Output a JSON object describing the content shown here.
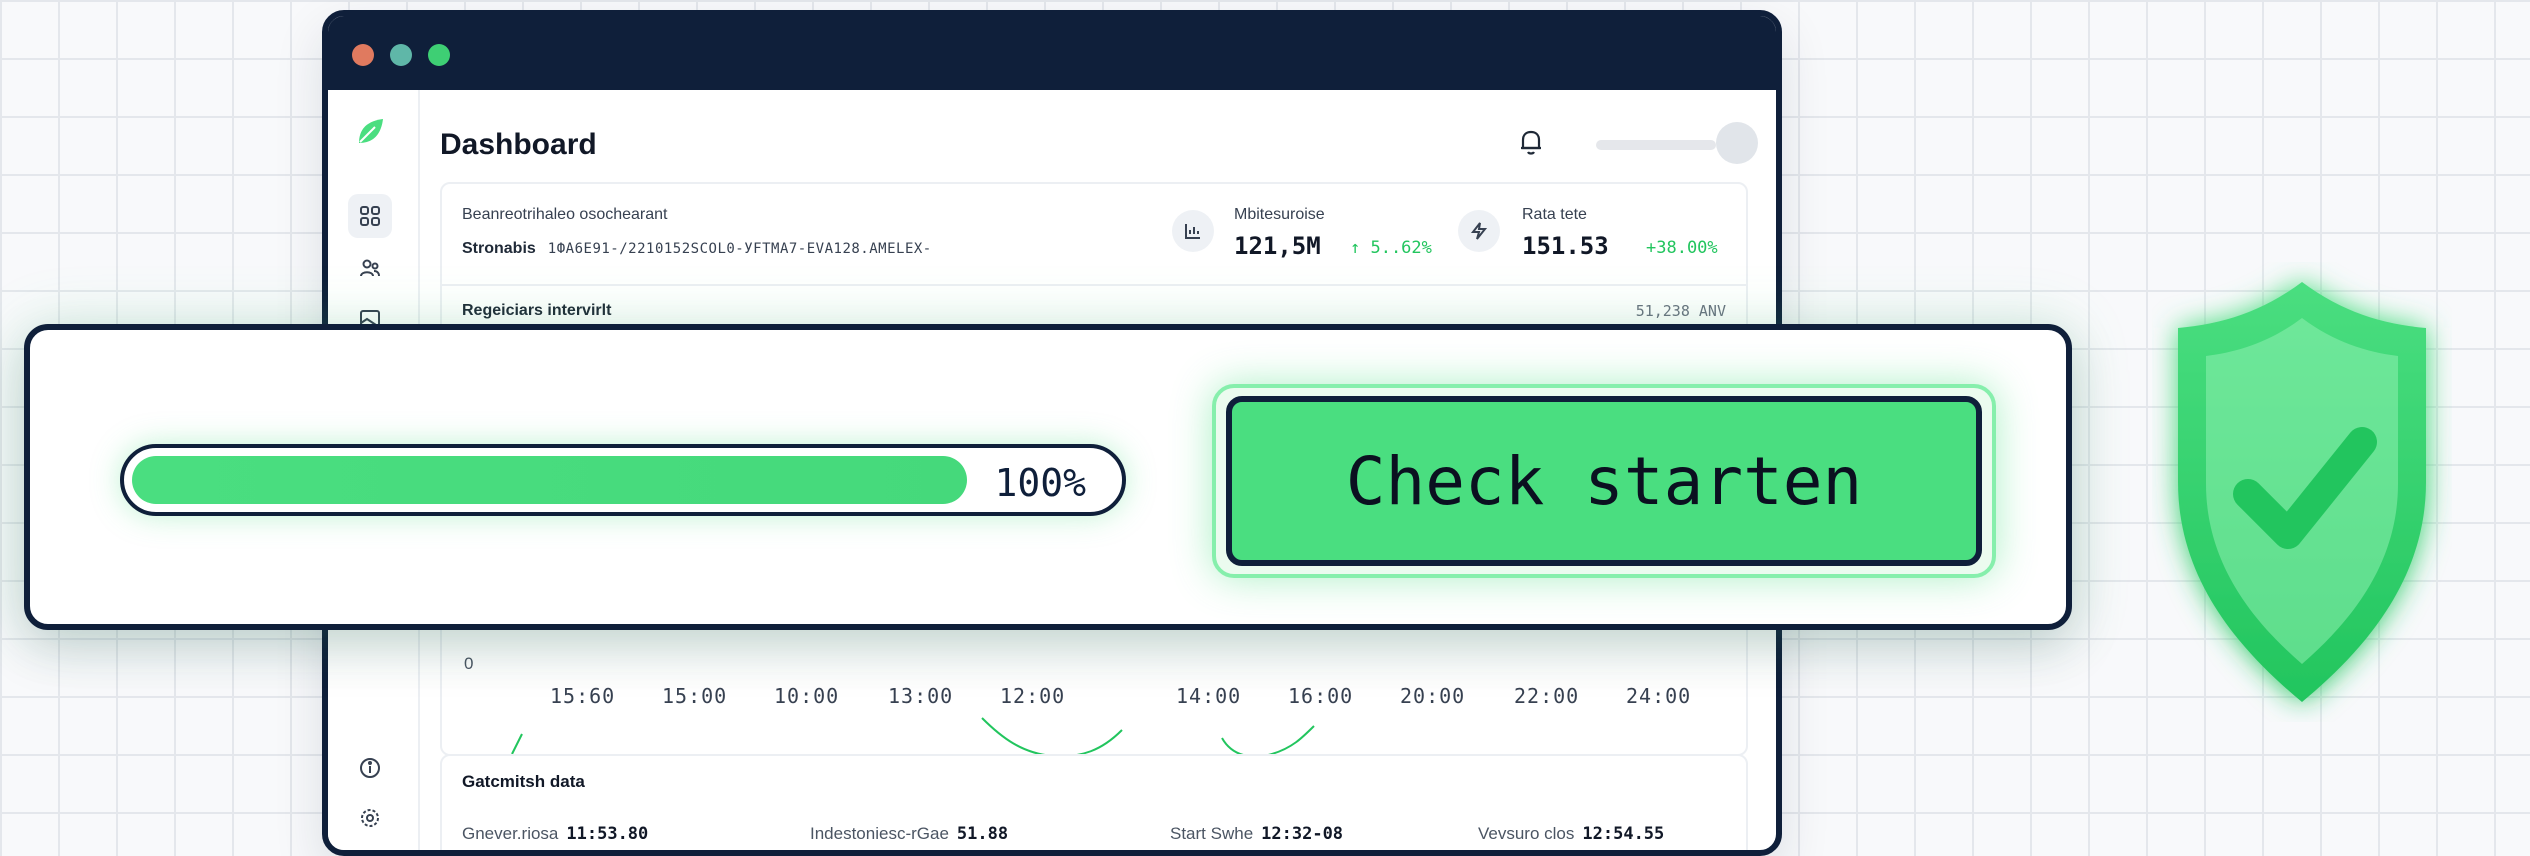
{
  "app": {
    "page_title": "Dashboard"
  },
  "sidebar": {
    "items": [
      {
        "icon": "grid-icon",
        "active": true
      },
      {
        "icon": "users-icon",
        "active": false
      },
      {
        "icon": "image-icon",
        "active": false
      },
      {
        "icon": "info-icon",
        "active": false
      },
      {
        "icon": "settings-icon",
        "active": false
      }
    ]
  },
  "summary": {
    "line1": "Beanreotrihaleo osochearant",
    "line2_label": "Stronabis",
    "line2_value": "1ФА6Е91-/2210152SСОL0-УFTМА7-ЕVА128.АМЕLЕХ-",
    "metric1": {
      "label": "Mbitesuroise",
      "value": "121,5M",
      "delta": "↑ 5..62%"
    },
    "metric2": {
      "label": "Rata tete",
      "value": "151.53",
      "delta": "+38.00%"
    },
    "line3": "Regeiciars intervirlt",
    "line3_right": "51,238 ANV"
  },
  "chart": {
    "y_zero": "0",
    "x_ticks": [
      "15:60",
      "15:00",
      "10:00",
      "13:00",
      "12:00",
      "14:00",
      "16:00",
      "20:00",
      "22:00",
      "24:00"
    ]
  },
  "gen_data": {
    "title": "Gatcmitsh data",
    "items": [
      {
        "label": "Gnever.riosa",
        "value": "11:53.80"
      },
      {
        "label": "Indestoniesc-rGae",
        "value": "51.88"
      },
      {
        "label": "Start Swhe",
        "value": "12:32-08"
      },
      {
        "label": "Vevsuro clos",
        "value": "12:54.55"
      }
    ]
  },
  "check": {
    "progress_percent": 100,
    "progress_text": "100%",
    "fill_fraction": 0.85,
    "button_label": "Check starten"
  },
  "colors": {
    "accent": "#4ade80",
    "navy": "#0f1f3a",
    "delta_positive": "#22c55e"
  }
}
